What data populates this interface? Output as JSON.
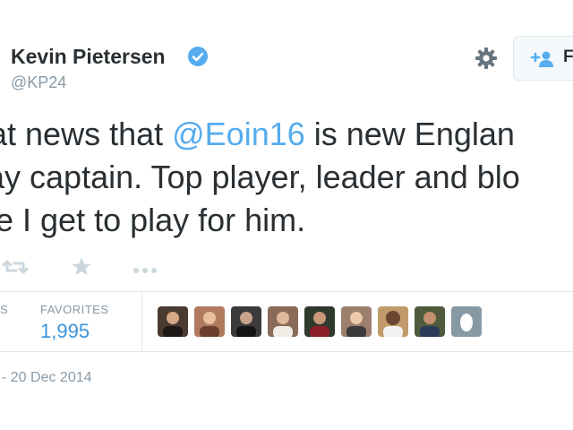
{
  "author": {
    "name": "Kevin Pietersen",
    "handle": "@KP24",
    "verified": true
  },
  "follow_button": {
    "label_visible": "F"
  },
  "tweet": {
    "line1_before": "at news that ",
    "mention": "@Eoin16",
    "line1_after": " is new Englan",
    "line2": "ay captain. Top player, leader and blo",
    "line3": "e I get to play for him."
  },
  "actions": {
    "retweet_icon": "retweet-icon",
    "favorite_icon": "star-icon",
    "more_icon": "more-icon"
  },
  "stats": {
    "retweets_label_visible": "S",
    "favorites_label": "FAVORITES",
    "favorites_count": "1,995",
    "favorited_by_avatar_count": 8,
    "avatar_colors": [
      "#4a3a30",
      "#b07a5e",
      "#3d3a3b",
      "#8a6a58",
      "#2e3a2c",
      "#9c7f6c",
      "#c09a6a",
      "#4f5a3c"
    ]
  },
  "date": "- 20 Dec 2014",
  "colors": {
    "link": "#55acee",
    "count": "#3b94d9",
    "muted": "#8899a6",
    "text": "#292f33"
  }
}
